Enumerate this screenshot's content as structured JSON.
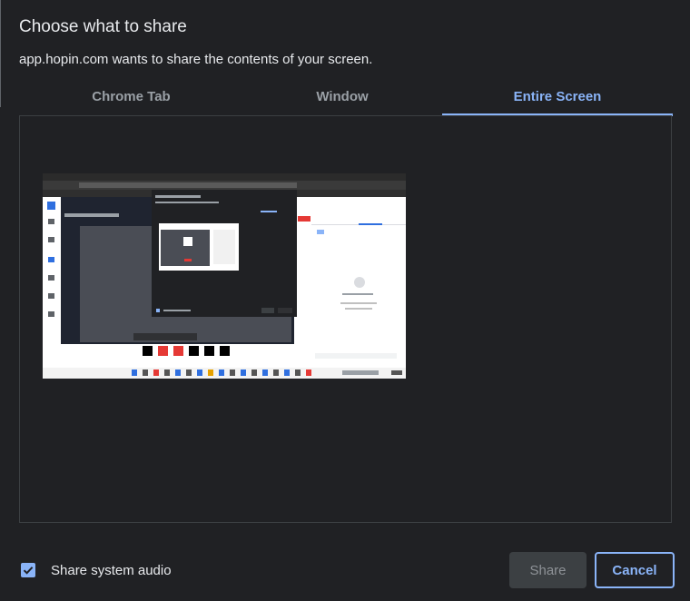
{
  "dialog": {
    "title": "Choose what to share",
    "subtitle": "app.hopin.com wants to share the contents of your screen."
  },
  "tabs": [
    {
      "label": "Chrome Tab",
      "selected": false
    },
    {
      "label": "Window",
      "selected": false
    },
    {
      "label": "Entire Screen",
      "selected": true
    }
  ],
  "footer": {
    "audio_label": "Share system audio",
    "audio_checked": true,
    "share_label": "Share",
    "cancel_label": "Cancel"
  },
  "colors": {
    "background": "#202124",
    "accent": "#8ab4f8",
    "text": "#e8eaed",
    "muted": "#9aa0a6"
  },
  "icons": {
    "checkbox": "checkmark-icon"
  }
}
